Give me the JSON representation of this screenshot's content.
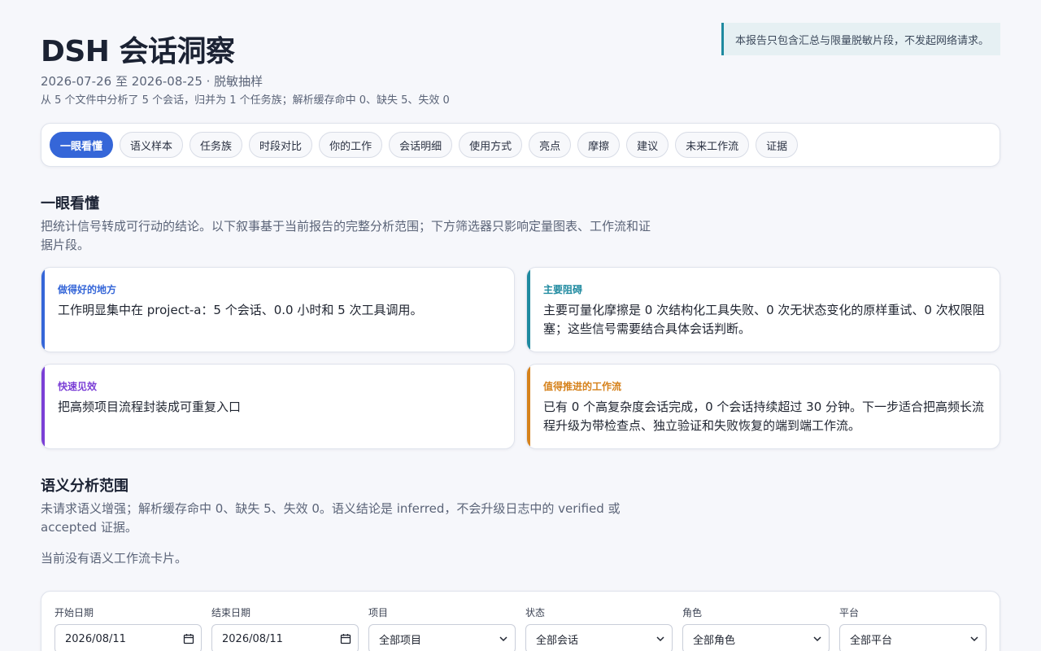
{
  "header": {
    "title": "DSH 会话洞察",
    "subtitle": "2026-07-26 至 2026-08-25 · 脱敏抽样",
    "meta": "从 5 个文件中分析了 5 个会话，归并为 1 个任务族；解析缓存命中 0、缺失 5、失效 0",
    "notice": "本报告只包含汇总与限量脱敏片段，不发起网络请求。"
  },
  "nav": {
    "tabs": [
      "一眼看懂",
      "语义样本",
      "任务族",
      "时段对比",
      "你的工作",
      "会话明细",
      "使用方式",
      "亮点",
      "摩擦",
      "建议",
      "未来工作流",
      "证据"
    ],
    "active_index": 0
  },
  "overview": {
    "heading": "一眼看懂",
    "description": "把统计信号转成可行动的结论。以下叙事基于当前报告的完整分析范围；下方筛选器只影响定量图表、工作流和证据片段。",
    "cards": [
      {
        "label": "做得好的地方",
        "text": "工作明显集中在 project-a：5 个会话、0.0 小时和 5 次工具调用。",
        "accent": "#3566d8"
      },
      {
        "label": "主要阻碍",
        "text": "主要可量化摩擦是 0 次结构化工具失败、0 次无状态变化的原样重试、0 次权限阻塞；这些信号需要结合具体会话判断。",
        "accent": "#1f8aa0"
      },
      {
        "label": "快速见效",
        "text": "把高频项目流程封装成可重复入口",
        "accent": "#7b3fd6"
      },
      {
        "label": "值得推进的工作流",
        "text": "已有 0 个高复杂度会话完成，0 个会话持续超过 30 分钟。下一步适合把高频长流程升级为带检查点、独立验证和失败恢复的端到端工作流。",
        "accent": "#d6821c"
      }
    ]
  },
  "semantic": {
    "heading": "语义分析范围",
    "description": "未请求语义增强；解析缓存命中 0、缺失 5、失效 0。语义结论是 inferred，不会升级日志中的 verified 或 accepted 证据。",
    "empty_note": "当前没有语义工作流卡片。"
  },
  "filters": {
    "start_date": {
      "label": "开始日期",
      "value": "2026/08/11"
    },
    "end_date": {
      "label": "结束日期",
      "value": "2026/08/11"
    },
    "project": {
      "label": "项目",
      "value": "全部项目"
    },
    "status": {
      "label": "状态",
      "value": "全部会话"
    },
    "role": {
      "label": "角色",
      "value": "全部角色"
    },
    "platform": {
      "label": "平台",
      "value": "全部平台"
    }
  }
}
